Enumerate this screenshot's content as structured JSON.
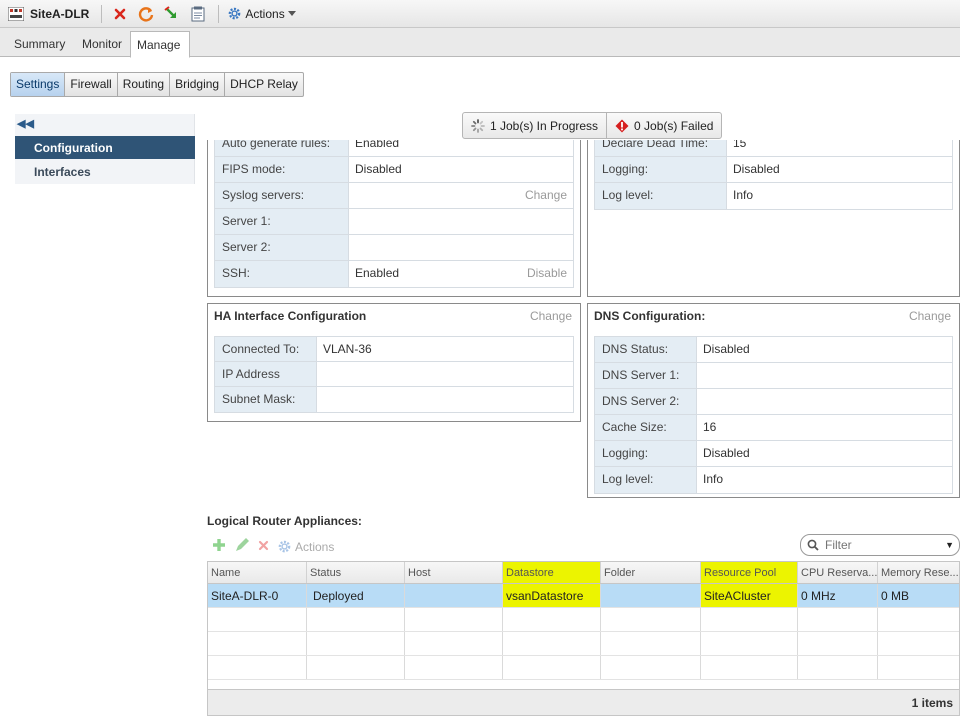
{
  "toolbar": {
    "title": "SiteA-DLR",
    "actions_label": "Actions",
    "colors": {
      "delete": "#d9261c",
      "refresh": "#e8741a",
      "migrate": "#2f9a2f"
    }
  },
  "top_tabs": [
    {
      "label": "Summary"
    },
    {
      "label": "Monitor"
    },
    {
      "label": "Manage",
      "active": true
    }
  ],
  "sub_tabs": [
    {
      "label": "Settings",
      "active": true
    },
    {
      "label": "Firewall"
    },
    {
      "label": "Routing"
    },
    {
      "label": "Bridging"
    },
    {
      "label": "DHCP Relay"
    }
  ],
  "left_nav": {
    "collapse_icon": "double-chevron-left-icon",
    "items": [
      {
        "label": "Configuration",
        "active": true
      },
      {
        "label": "Interfaces"
      }
    ]
  },
  "jobs": {
    "in_progress": "1 Job(s) In Progress",
    "failed": "0 Job(s) Failed"
  },
  "general_panel": {
    "rows": [
      {
        "key": "Auto generate rules:",
        "value": "Enabled",
        "action": ""
      },
      {
        "key": "FIPS mode:",
        "value": "Disabled",
        "action": ""
      },
      {
        "key": "Syslog servers:",
        "value": "",
        "action": "Change"
      },
      {
        "key": "Server 1:",
        "value": "",
        "action": ""
      },
      {
        "key": "Server 2:",
        "value": "",
        "action": ""
      },
      {
        "key": "SSH:",
        "value": "Enabled",
        "action": "Disable"
      }
    ]
  },
  "ha_panel": {
    "rows": [
      {
        "key": "Declare Dead Time:",
        "value": "15"
      },
      {
        "key": "Logging:",
        "value": "Disabled"
      },
      {
        "key": "Log level:",
        "value": "Info"
      }
    ]
  },
  "ha_interface": {
    "title": "HA Interface Configuration",
    "change": "Change",
    "rows": [
      {
        "key": "Connected To:",
        "value": "VLAN-36"
      },
      {
        "key": "IP Address",
        "value": ""
      },
      {
        "key": "Subnet Mask:",
        "value": ""
      }
    ]
  },
  "dns": {
    "title": "DNS Configuration:",
    "change": "Change",
    "rows": [
      {
        "key": "DNS Status:",
        "value": "Disabled"
      },
      {
        "key": "DNS Server 1:",
        "value": ""
      },
      {
        "key": "DNS Server 2:",
        "value": ""
      },
      {
        "key": "Cache Size:",
        "value": "16"
      },
      {
        "key": "Logging:",
        "value": "Disabled"
      },
      {
        "key": "Log level:",
        "value": "Info"
      }
    ]
  },
  "appliances": {
    "title": "Logical Router Appliances:",
    "actions_label": "Actions",
    "filter_placeholder": "Filter",
    "columns": [
      "Name",
      "Status",
      "Host",
      "Datastore",
      "Folder",
      "Resource Pool",
      "CPU Reserva...",
      "Memory Rese..."
    ],
    "rows": [
      [
        "SiteA-DLR-0",
        "Deployed",
        "",
        "vsanDatastore",
        "",
        "SiteACluster",
        "0 MHz",
        "0 MB"
      ]
    ],
    "empty_rows": 3,
    "footer": "1 items",
    "highlight_color": "#ecf400"
  }
}
